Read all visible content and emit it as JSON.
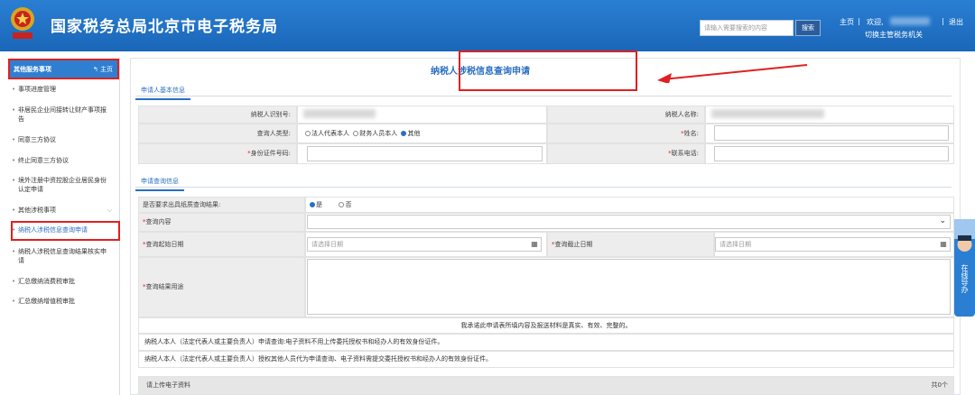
{
  "header": {
    "title": "国家税务总局北京市电子税务局",
    "emblem_text": "中国税务",
    "search_placeholder": "请输入需要搜索的内容",
    "search_button": "搜索",
    "home": "主页",
    "welcome": "欢迎,",
    "switch_org": "切换主管税务机关",
    "logout": "退出"
  },
  "sidebar": {
    "title": "其他服务事项",
    "home": "主页",
    "items": [
      "事项进度管理",
      "非居民企业间接转让财产事项报告",
      "同意三方协议",
      "终止同意三方协议",
      "境外注册中资控股企业居民身份认定申请",
      "其他涉税事项",
      "纳税人涉税信息查询申请",
      "纳税人涉税信息查询结果核实申请",
      "汇总缴纳消费税审批",
      "汇总缴纳增值税审批"
    ]
  },
  "form": {
    "title": "纳税人涉税信息查询申请",
    "section1": "申请人基本信息",
    "taxpayer_id_label": "纳税人识别号:",
    "taxpayer_name_label": "纳税人名称:",
    "querier_type_label": "查询人类型:",
    "querier_options": [
      "法人代表本人",
      "财务人员本人",
      "其他"
    ],
    "name_label": "姓名:",
    "id_no_label": "身份证件号码:",
    "phone_label": "联系电话:",
    "section2": "申请查询信息",
    "need_paper_label": "是否要求出具纸质查询结果:",
    "yes": "是",
    "no": "否",
    "query_content_label": "查询内容",
    "start_date_label": "查询起始日期",
    "end_date_label": "查询截止日期",
    "date_placeholder": "请选择日期",
    "purpose_label": "查询结果用途",
    "promise": "我承诺此申请表所填内容及报送材料是真实、有效、完整的。",
    "note1": "纳税人本人（法定代表人或主要负责人）申请查询:电子资料不用上传委托授权书和经办人的有效身份证件。",
    "note2": "纳税人本人（法定代表人或主要负责人）授权其他人员代为申请查询、电子资料需提交委托授权书和经办人的有效身份证件。",
    "upload_label": "请上传电子资料",
    "upload_count": "共0个"
  },
  "float": {
    "label": "在线导办"
  }
}
